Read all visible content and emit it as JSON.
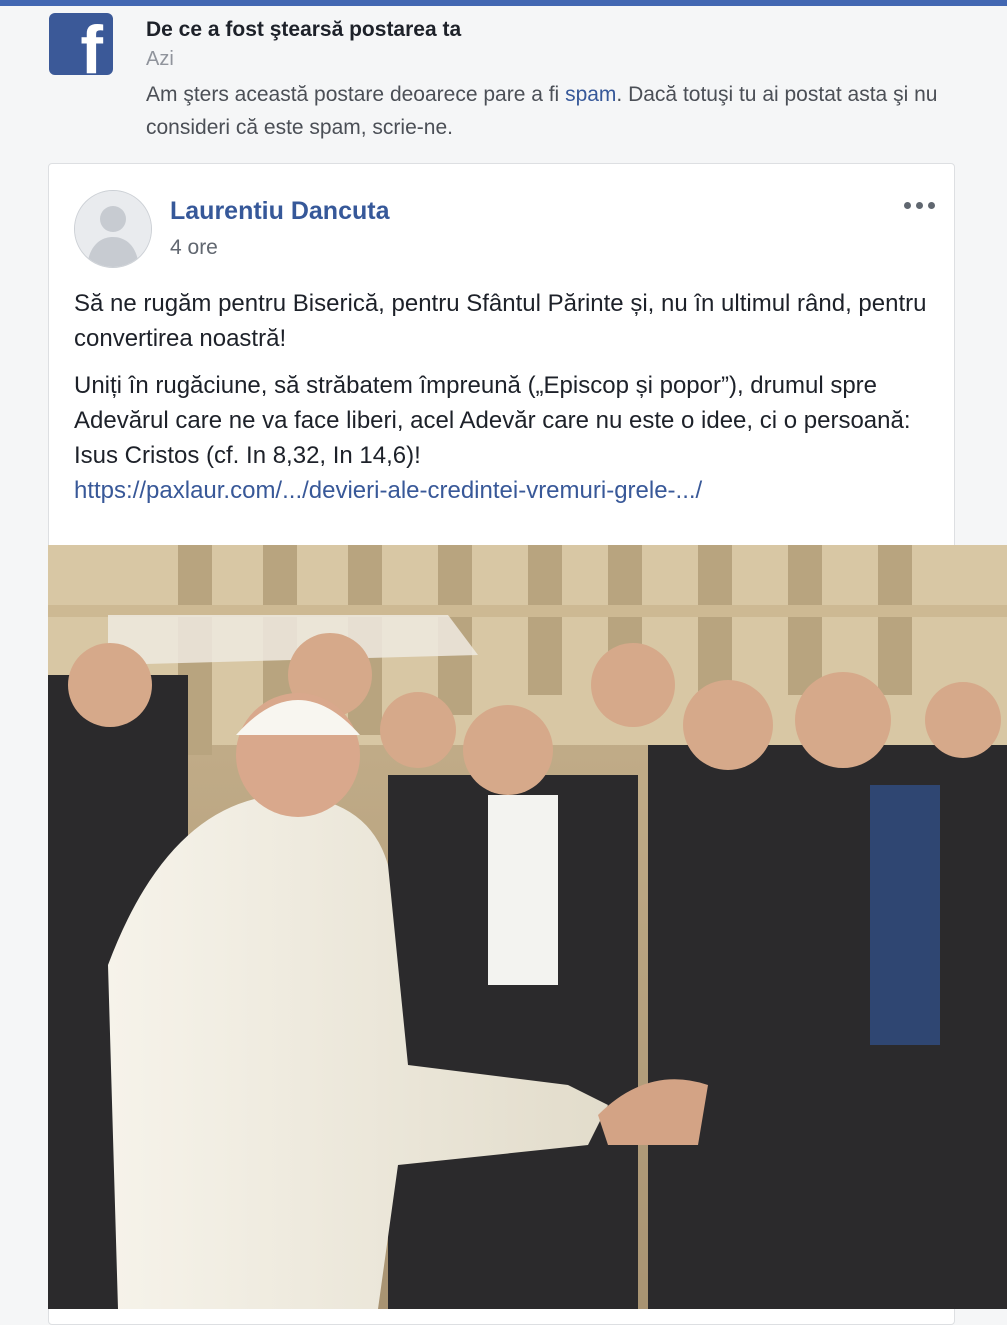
{
  "notification": {
    "icon": "facebook-logo-icon",
    "brand_color": "#3b5998",
    "title": "De ce a fost ştearsă postarea ta",
    "time": "Azi",
    "body_before": "Am şters această postare deoarece pare a fi ",
    "body_link": "spam",
    "body_after": ". Dacă totuşi tu ai postat asta şi nu consideri că este spam, scrie-ne."
  },
  "post": {
    "author": "Laurentiu Dancuta",
    "time": "4 ore",
    "more_icon": "more-options-icon",
    "paragraph1": "Să ne rugăm pentru Biserică, pentru Sfântul Părinte și, nu în ultimul rând, pentru convertirea noastră!",
    "paragraph2": "Uniți în rugăciune, să străbatem împreună („Episcop și popor”), drumul spre Adevărul care ne va face liberi, acel Adevăr care nu este o idee, ci o persoană: Isus Cristos (cf. In 8,32, In 14,6)!",
    "link": "https://paxlaur.com/.../devieri-ale-credintei-vremuri-grele-.../",
    "photo": "group-photo-with-pope"
  }
}
